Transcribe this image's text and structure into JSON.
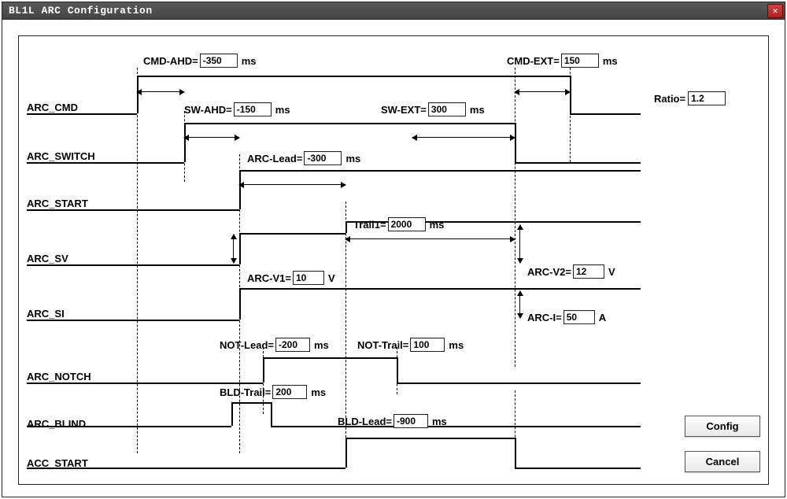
{
  "window": {
    "title": "BL1L ARC Configuration",
    "close_tooltip": "Close"
  },
  "signals": {
    "arc_cmd": "ARC_CMD",
    "arc_switch": "ARC_SWITCH",
    "arc_start": "ARC_START",
    "arc_sv": "ARC_SV",
    "arc_si": "ARC_SI",
    "arc_notch": "ARC_NOTCH",
    "arc_blind": "ARC_BLIND",
    "acc_start": "ACC_START"
  },
  "params": {
    "cmd_ahd": {
      "label": "CMD-AHD=",
      "value": "-350",
      "unit": "ms"
    },
    "cmd_ext": {
      "label": "CMD-EXT=",
      "value": "150",
      "unit": "ms"
    },
    "sw_ahd": {
      "label": "SW-AHD=",
      "value": "-150",
      "unit": "ms"
    },
    "sw_ext": {
      "label": "SW-EXT=",
      "value": "300",
      "unit": "ms"
    },
    "arc_lead": {
      "label": "ARC-Lead=",
      "value": "-300",
      "unit": "ms"
    },
    "trail1": {
      "label": "Trail1=",
      "value": "2000",
      "unit": "ms"
    },
    "arc_v1": {
      "label": "ARC-V1=",
      "value": "10",
      "unit": "V"
    },
    "arc_v2": {
      "label": "ARC-V2=",
      "value": "12",
      "unit": "V"
    },
    "arc_i": {
      "label": "ARC-I=",
      "value": "50",
      "unit": "A"
    },
    "not_lead": {
      "label": "NOT-Lead=",
      "value": "-200",
      "unit": "ms"
    },
    "not_trail": {
      "label": "NOT-Trail=",
      "value": "100",
      "unit": "ms"
    },
    "bld_trail": {
      "label": "BLD-Trail=",
      "value": "200",
      "unit": "ms"
    },
    "bld_lead": {
      "label": "BLD-Lead=",
      "value": "-900",
      "unit": "ms"
    },
    "ratio": {
      "label": "Ratio=",
      "value": "1.2",
      "unit": ""
    }
  },
  "buttons": {
    "config": "Config",
    "cancel": "Cancel"
  }
}
